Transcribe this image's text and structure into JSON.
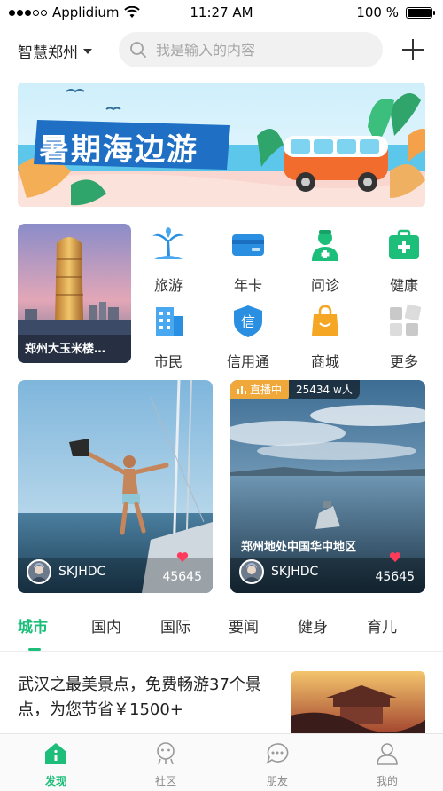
{
  "status_bar": {
    "carrier": "Applidium",
    "time": "11:27 AM",
    "battery": "100 %"
  },
  "header": {
    "city": "智慧郑州",
    "search_placeholder": "我是输入的内容"
  },
  "banner": {
    "title": "暑期海边游"
  },
  "feature_card": {
    "label": "郑州大玉米楼…"
  },
  "grid": [
    {
      "label": "旅游",
      "icon": "palm-tree-icon"
    },
    {
      "label": "年卡",
      "icon": "card-icon"
    },
    {
      "label": "问诊",
      "icon": "doctor-icon"
    },
    {
      "label": "健康",
      "icon": "medical-kit-icon"
    },
    {
      "label": "市民",
      "icon": "building-icon"
    },
    {
      "label": "信用通",
      "icon": "credit-shield-icon"
    },
    {
      "label": "商城",
      "icon": "shopping-bag-icon"
    },
    {
      "label": "更多",
      "icon": "more-grid-icon"
    }
  ],
  "cards": [
    {
      "user": "SKJHDC",
      "likes": "45645"
    },
    {
      "live_label": "直播中",
      "viewers": "25434 w人",
      "caption": "郑州地处中国华中地区",
      "user": "SKJHDC",
      "likes": "45645"
    }
  ],
  "tabs": [
    "城市",
    "国内",
    "国际",
    "要闻",
    "健身",
    "育儿"
  ],
  "article": {
    "text": "武汉之最美景点，免费畅游37个景点，为您节省￥1500+"
  },
  "bottom_nav": [
    {
      "label": "发现",
      "active": true
    },
    {
      "label": "社区",
      "active": false
    },
    {
      "label": "朋友",
      "active": false
    },
    {
      "label": "我的",
      "active": false
    }
  ],
  "colors": {
    "accent": "#1dbe7a",
    "live_badge": "#f0a83b",
    "heart": "#ff3b5c"
  }
}
